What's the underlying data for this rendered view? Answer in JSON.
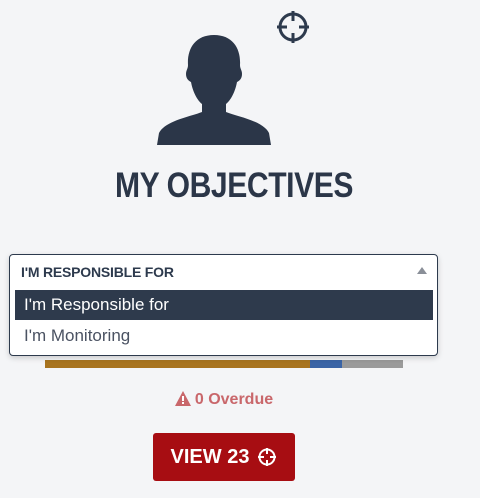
{
  "header": {
    "title": "MY OBJECTIVES"
  },
  "icons": {
    "top_action": "crosshair-target-icon",
    "avatar": "user-silhouette-icon",
    "overdue": "warning-triangle-icon",
    "view_button": "crosshair-target-icon"
  },
  "dropdown": {
    "selected_label": "I'M RESPONSIBLE FOR",
    "options": [
      {
        "label": "I'm Responsible for",
        "highlighted": true
      },
      {
        "label": "I'm Monitoring",
        "highlighted": false
      }
    ]
  },
  "progress": {
    "segments": [
      {
        "fraction": 0.74,
        "color": "#a8741f"
      },
      {
        "fraction": 0.09,
        "color": "#3a64a6"
      },
      {
        "fraction": 0.17,
        "color": "#9a9a9a"
      }
    ]
  },
  "overdue": {
    "text": "0 Overdue",
    "color": "#c9676b"
  },
  "view_button": {
    "label": "VIEW 23",
    "color": "#a70d12"
  },
  "colors": {
    "primary_dark": "#2d3a4d",
    "background": "#f4f5f7"
  }
}
